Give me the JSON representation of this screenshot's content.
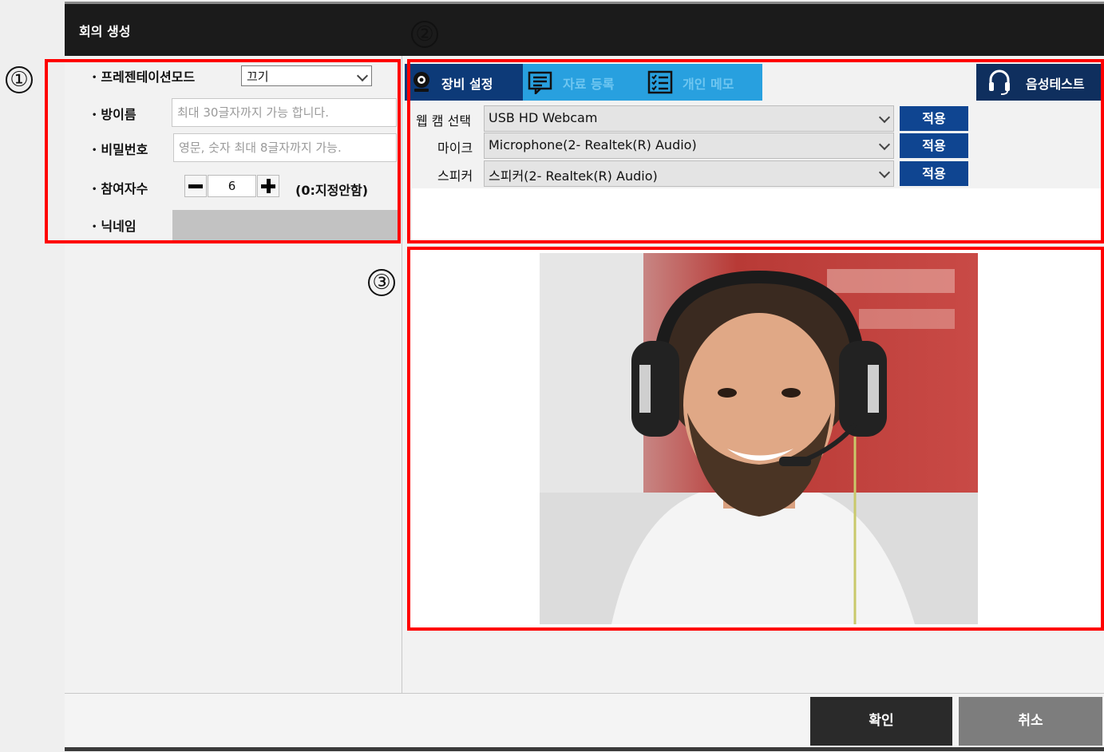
{
  "window": {
    "title": "회의 생성"
  },
  "annotations": {
    "one": "①",
    "two": "②",
    "three": "③"
  },
  "settings": {
    "presentation_mode_label": "프레젠테이션모드",
    "presentation_mode_value": "끄기",
    "room_name_label": "방이름",
    "room_name_placeholder": "최대 30글자까지 가능 합니다.",
    "password_label": "비밀번호",
    "password_placeholder": "영문, 숫자 최대 8글자까지 가능.",
    "participants_label": "참여자수",
    "participants_value": "6",
    "participants_hint": "(0:지정안함)",
    "nickname_label": "닉네임"
  },
  "tabs": [
    {
      "label": "장비 설정",
      "icon": "webcam-icon"
    },
    {
      "label": "자료 등록",
      "icon": "document-icon"
    },
    {
      "label": "개인 메모",
      "icon": "checklist-icon"
    },
    {
      "label": "음성테스트",
      "icon": "headset-icon"
    }
  ],
  "devices": {
    "webcam_label": "웹 캠 선택",
    "webcam_value": "USB HD Webcam",
    "mic_label": "마이크",
    "mic_value": "Microphone(2- Realtek(R) Audio)",
    "speaker_label": "스피커",
    "speaker_value": "스피커(2- Realtek(R) Audio)",
    "apply_label": "적용"
  },
  "footer": {
    "ok_label": "확인",
    "cancel_label": "취소"
  },
  "colors": {
    "tab_active": "#0d3a78",
    "tab_inactive": "#28a0df",
    "apply": "#0f4591",
    "annotation": "#ff0000"
  }
}
